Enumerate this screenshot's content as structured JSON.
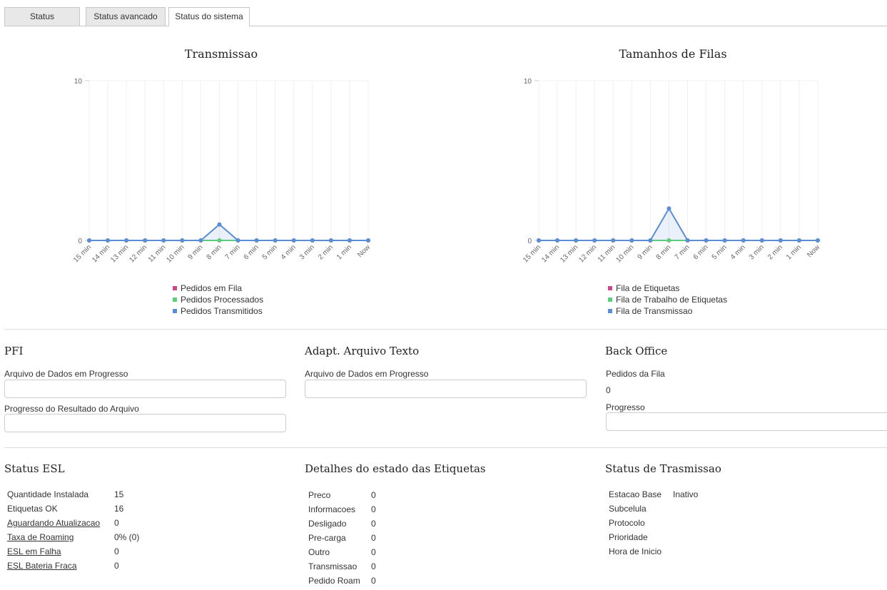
{
  "tabs": [
    {
      "label": "Status"
    },
    {
      "label": "Status avancado"
    },
    {
      "label": "Status do sistema"
    }
  ],
  "charts": [
    {
      "title": "Transmissao",
      "legend": [
        {
          "label": "Pedidos em Fila",
          "color": "#c94a8a"
        },
        {
          "label": "Pedidos Processados",
          "color": "#5dcf7a"
        },
        {
          "label": "Pedidos Transmitidos",
          "color": "#5b8dd6"
        }
      ]
    },
    {
      "title": "Tamanhos de Filas",
      "legend": [
        {
          "label": "Fila de Etiquetas",
          "color": "#c94a8a"
        },
        {
          "label": "Fila de Trabalho de Etiquetas",
          "color": "#5dcf7a"
        },
        {
          "label": "Fila de Transmissao",
          "color": "#5b8dd6"
        }
      ]
    }
  ],
  "chart_data": [
    {
      "type": "line",
      "title": "Transmissao",
      "categories": [
        "15 min",
        "14 min",
        "13 min",
        "12 min",
        "11 min",
        "10 min",
        "9 min",
        "8 min",
        "7 min",
        "6 min",
        "5 min",
        "4 min",
        "3 min",
        "2 min",
        "1 min",
        "Now"
      ],
      "ylim": [
        0,
        10
      ],
      "yticks": [
        "0",
        "10"
      ],
      "series": [
        {
          "name": "Pedidos em Fila",
          "color": "#c94a8a",
          "values": [
            0,
            0,
            0,
            0,
            0,
            0,
            0,
            0,
            0,
            0,
            0,
            0,
            0,
            0,
            0,
            0
          ]
        },
        {
          "name": "Pedidos Processados",
          "color": "#5dcf7a",
          "values": [
            0,
            0,
            0,
            0,
            0,
            0,
            0,
            0,
            0,
            0,
            0,
            0,
            0,
            0,
            0,
            0
          ]
        },
        {
          "name": "Pedidos Transmitidos",
          "color": "#5b8dd6",
          "values": [
            0,
            0,
            0,
            0,
            0,
            0,
            0,
            1,
            0,
            0,
            0,
            0,
            0,
            0,
            0,
            0
          ]
        }
      ]
    },
    {
      "type": "line",
      "title": "Tamanhos de Filas",
      "categories": [
        "15 min",
        "14 min",
        "13 min",
        "12 min",
        "11 min",
        "10 min",
        "9 min",
        "8 min",
        "7 min",
        "6 min",
        "5 min",
        "4 min",
        "3 min",
        "2 min",
        "1 min",
        "Now"
      ],
      "ylim": [
        0,
        10
      ],
      "yticks": [
        "0",
        "10"
      ],
      "series": [
        {
          "name": "Fila de Etiquetas",
          "color": "#c94a8a",
          "values": [
            0,
            0,
            0,
            0,
            0,
            0,
            0,
            0,
            0,
            0,
            0,
            0,
            0,
            0,
            0,
            0
          ]
        },
        {
          "name": "Fila de Trabalho de Etiquetas",
          "color": "#5dcf7a",
          "values": [
            0,
            0,
            0,
            0,
            0,
            0,
            0,
            0,
            0,
            0,
            0,
            0,
            0,
            0,
            0,
            0
          ]
        },
        {
          "name": "Fila de Transmissao",
          "color": "#5b8dd6",
          "values": [
            0,
            0,
            0,
            0,
            0,
            0,
            0,
            2,
            0,
            0,
            0,
            0,
            0,
            0,
            0,
            0
          ]
        }
      ]
    }
  ],
  "pfi": {
    "title": "PFI",
    "field1_label": "Arquivo de Dados em Progresso",
    "field2_label": "Progresso do Resultado do Arquivo"
  },
  "adapt": {
    "title": "Adapt. Arquivo Texto",
    "field1_label": "Arquivo de Dados em Progresso"
  },
  "backoffice": {
    "title": "Back Office",
    "queue_label": "Pedidos da Fila",
    "queue_value": "0",
    "progress_label": "Progresso"
  },
  "status_esl": {
    "title": "Status ESL",
    "rows": [
      {
        "label": "Quantidade Instalada",
        "value": "15"
      },
      {
        "label": "Etiquetas OK",
        "value": "16"
      },
      {
        "label": "Aguardando Atualizacao",
        "value": "0"
      },
      {
        "label": "Taxa de Roaming",
        "value": "0% (0)"
      },
      {
        "label": "ESL em Falha",
        "value": "0"
      },
      {
        "label": "ESL Bateria Fraca",
        "value": "0"
      }
    ]
  },
  "tag_details": {
    "title": "Detalhes do estado das Etiquetas",
    "rows": [
      {
        "label": "Preco",
        "value": "0"
      },
      {
        "label": "Informacoes",
        "value": "0"
      },
      {
        "label": "Desligado",
        "value": "0"
      },
      {
        "label": "Pre-carga",
        "value": "0"
      },
      {
        "label": "Outro",
        "value": "0"
      },
      {
        "label": "Transmissao",
        "value": "0"
      },
      {
        "label": "Pedido Roam",
        "value": "0"
      }
    ]
  },
  "trans_status": {
    "title": "Status de Trasmissao",
    "rows": [
      {
        "label": "Estacao Base",
        "value": "Inativo"
      },
      {
        "label": "Subcelula",
        "value": ""
      },
      {
        "label": "Protocolo",
        "value": ""
      },
      {
        "label": "Prioridade",
        "value": ""
      },
      {
        "label": "Hora de Inicio",
        "value": ""
      }
    ]
  }
}
